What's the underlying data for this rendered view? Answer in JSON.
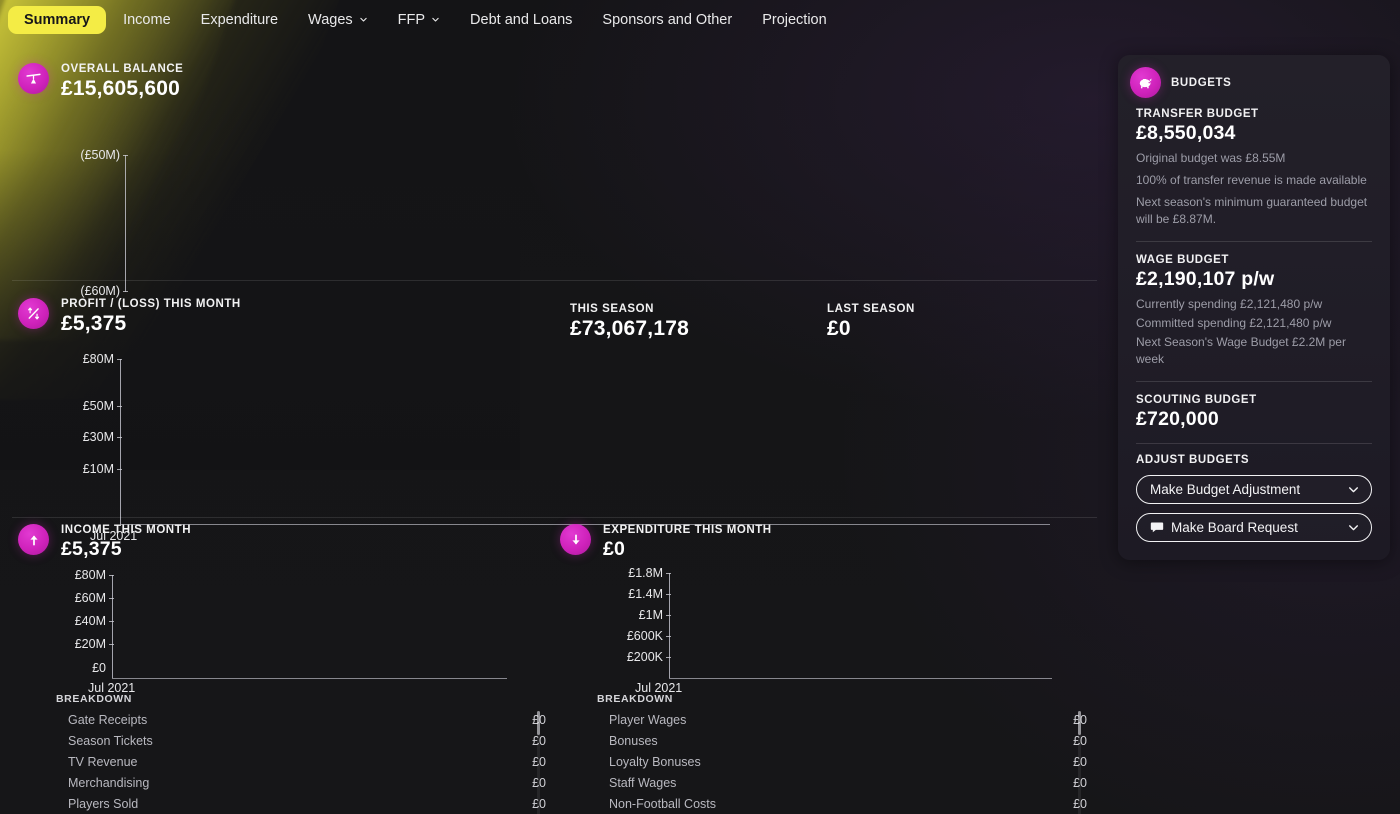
{
  "tabs": [
    {
      "label": "Summary",
      "active": true,
      "chevron": false
    },
    {
      "label": "Income",
      "active": false,
      "chevron": false
    },
    {
      "label": "Expenditure",
      "active": false,
      "chevron": false
    },
    {
      "label": "Wages",
      "active": false,
      "chevron": true
    },
    {
      "label": "FFP",
      "active": false,
      "chevron": true
    },
    {
      "label": "Debt and Loans",
      "active": false,
      "chevron": false
    },
    {
      "label": "Sponsors and Other",
      "active": false,
      "chevron": false
    },
    {
      "label": "Projection",
      "active": false,
      "chevron": false
    }
  ],
  "overall_balance": {
    "icon": "balance-scales-icon",
    "title": "OVERALL BALANCE",
    "value": "£15,605,600"
  },
  "profit_loss": {
    "icon": "profit-loss-icon",
    "title": "PROFIT / (LOSS) THIS MONTH",
    "value": "£5,375",
    "this_season_label": "THIS SEASON",
    "this_season_value": "£73,067,178",
    "last_season_label": "LAST SEASON",
    "last_season_value": "£0"
  },
  "income": {
    "icon": "arrow-up-icon",
    "title": "INCOME THIS MONTH",
    "value": "£5,375",
    "breakdown_label": "BREAKDOWN",
    "rows": [
      {
        "label": "Gate Receipts",
        "value": "£0"
      },
      {
        "label": "Season Tickets",
        "value": "£0"
      },
      {
        "label": "TV Revenue",
        "value": "£0"
      },
      {
        "label": "Merchandising",
        "value": "£0"
      },
      {
        "label": "Players Sold",
        "value": "£0"
      }
    ]
  },
  "expenditure": {
    "icon": "arrow-down-icon",
    "title": "EXPENDITURE THIS MONTH",
    "value": "£0",
    "breakdown_label": "BREAKDOWN",
    "rows": [
      {
        "label": "Player Wages",
        "value": "£0"
      },
      {
        "label": "Bonuses",
        "value": "£0"
      },
      {
        "label": "Loyalty Bonuses",
        "value": "£0"
      },
      {
        "label": "Staff Wages",
        "value": "£0"
      },
      {
        "label": "Non-Football Costs",
        "value": "£0"
      }
    ]
  },
  "budgets": {
    "icon": "piggy-bank-icon",
    "title": "BUDGETS",
    "transfer_label": "TRANSFER BUDGET",
    "transfer_value": "£8,550,034",
    "transfer_notes": [
      "Original budget was £8.55M",
      "100% of transfer revenue is made available",
      "Next season's minimum guaranteed budget will be £8.87M."
    ],
    "wage_label": "WAGE BUDGET",
    "wage_value": "£2,190,107 p/w",
    "wage_notes": [
      "Currently spending £2,121,480 p/w",
      "Committed spending £2,121,480 p/w",
      "Next Season's Wage Budget £2.2M per week"
    ],
    "scouting_label": "SCOUTING BUDGET",
    "scouting_value": "£720,000",
    "adjust_label": "ADJUST BUDGETS",
    "dropdowns": [
      {
        "label": "Make Budget Adjustment",
        "icon": null
      },
      {
        "label": "Make Board Request",
        "icon": "speech-bubble-icon"
      }
    ]
  },
  "colors": {
    "accent_yellow": "#f4ec45",
    "accent_magenta": "#cf22bb",
    "background": "#141416",
    "panel": "#221f2a"
  },
  "chart_data": [
    {
      "type": "line",
      "name": "overall-balance-chart",
      "title": "OVERALL BALANCE",
      "categories": [],
      "values": [],
      "ytick_labels": [
        "(£50M)",
        "(£60M)"
      ],
      "ytick_values": [
        -50000000,
        -60000000
      ],
      "xlabel": "",
      "ylabel": "",
      "xtick_labels": [],
      "grid": false,
      "legend": false
    },
    {
      "type": "line",
      "name": "profit-loss-chart",
      "title": "PROFIT / (LOSS) THIS MONTH",
      "categories": [
        "Jul 2021"
      ],
      "values": [],
      "ytick_labels": [
        "£80M",
        "£50M",
        "£30M",
        "£10M"
      ],
      "ytick_values": [
        80000000,
        50000000,
        30000000,
        10000000
      ],
      "xtick_labels": [
        "Jul 2021"
      ],
      "xlabel": "",
      "ylabel": "",
      "grid": false,
      "legend": false
    },
    {
      "type": "line",
      "name": "income-chart",
      "title": "INCOME THIS MONTH",
      "categories": [
        "Jul 2021"
      ],
      "values": [],
      "ytick_labels": [
        "£80M",
        "£60M",
        "£40M",
        "£20M",
        "£0"
      ],
      "ytick_values": [
        80000000,
        60000000,
        40000000,
        20000000,
        0
      ],
      "xtick_labels": [
        "Jul 2021"
      ],
      "xlabel": "",
      "ylabel": "",
      "grid": false,
      "legend": false
    },
    {
      "type": "line",
      "name": "expenditure-chart",
      "title": "EXPENDITURE THIS MONTH",
      "categories": [
        "Jul 2021"
      ],
      "values": [],
      "ytick_labels": [
        "£1.8M",
        "£1.4M",
        "£1M",
        "£600K",
        "£200K"
      ],
      "ytick_values": [
        1800000,
        1400000,
        1000000,
        600000,
        200000
      ],
      "xtick_labels": [
        "Jul 2021"
      ],
      "xlabel": "",
      "ylabel": "",
      "grid": false,
      "legend": false
    }
  ]
}
